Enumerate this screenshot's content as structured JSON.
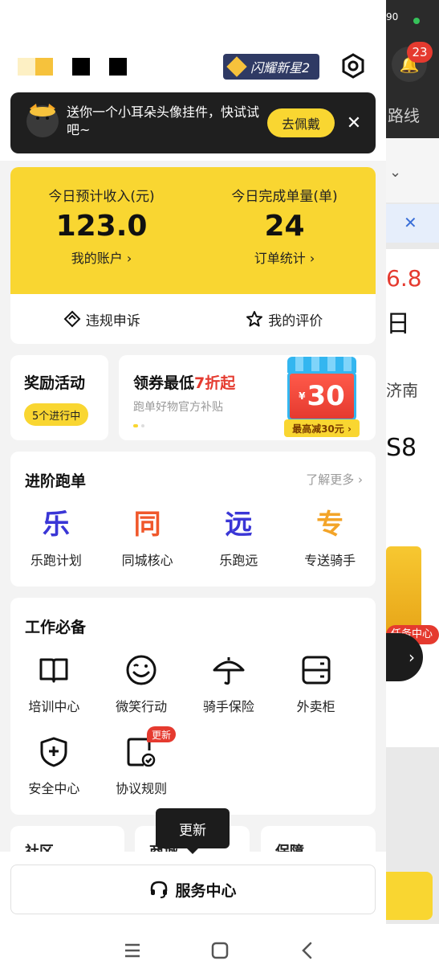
{
  "background": {
    "status_battery": "90",
    "notification_count": "23",
    "route_label": "路线",
    "price_fragment": "6.8",
    "date_fragment": "日",
    "city_fragment": "济南",
    "code_fragment": "S8",
    "gift_label": "任务中心"
  },
  "header": {
    "level_badge": "闪耀新星2"
  },
  "promo": {
    "text": "送你一个小耳朵头像挂件，快试试吧~",
    "button": "去佩戴"
  },
  "income": {
    "left": {
      "label": "今日预计收入(元)",
      "value": "123.0",
      "link": "我的账户 ›"
    },
    "right": {
      "label": "今日完成单量(单)",
      "value": "24",
      "link": "订单统计 ›"
    },
    "actions": [
      {
        "label": "违规申诉"
      },
      {
        "label": "我的评价"
      }
    ]
  },
  "reward": {
    "title": "奖励活动",
    "status": "5个进行中"
  },
  "coupon": {
    "title_prefix": "领券最低",
    "title_highlight": "7折起",
    "subtitle": "跑单好物官方补贴",
    "amount": "30",
    "currency": "¥",
    "bottom": "最高减30元 ›"
  },
  "advanced": {
    "title": "进阶跑单",
    "more": "了解更多 ›",
    "items": [
      {
        "glyph": "乐",
        "label": "乐跑计划",
        "color": "#3a36d6"
      },
      {
        "glyph": "同",
        "label": "同城核心",
        "color": "#f0582b"
      },
      {
        "glyph": "远",
        "label": "乐跑远",
        "color": "#3a36d6"
      },
      {
        "glyph": "专",
        "label": "专送骑手",
        "color": "#f3a428"
      }
    ]
  },
  "work": {
    "title": "工作必备",
    "items": [
      {
        "label": "培训中心",
        "icon": "book-icon"
      },
      {
        "label": "微笑行动",
        "icon": "smile-icon"
      },
      {
        "label": "骑手保险",
        "icon": "umbrella-icon"
      },
      {
        "label": "外卖柜",
        "icon": "locker-icon"
      },
      {
        "label": "安全中心",
        "icon": "shield-icon"
      },
      {
        "label": "协议规则",
        "icon": "document-check-icon"
      }
    ],
    "new_badge": "更新"
  },
  "bottom_cards": [
    "社区",
    "商城",
    "保障"
  ],
  "tooltip": "更新",
  "service": {
    "label": "服务中心"
  }
}
